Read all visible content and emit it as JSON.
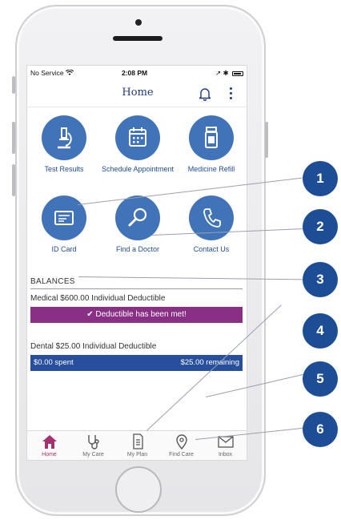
{
  "status_bar": {
    "carrier": "No Service",
    "time": "2:08 PM",
    "right": "↗ ✱"
  },
  "header": {
    "title": "Home"
  },
  "tiles": [
    {
      "label": "Test Results",
      "icon": "microscope-icon"
    },
    {
      "label": "Schedule Appointment",
      "icon": "calendar-icon"
    },
    {
      "label": "Medicine Refill",
      "icon": "pill-bottle-icon"
    },
    {
      "label": "ID Card",
      "icon": "id-card-icon"
    },
    {
      "label": "Find a Doctor",
      "icon": "magnifier-icon"
    },
    {
      "label": "Contact Us",
      "icon": "phone-icon"
    }
  ],
  "balances": {
    "heading": "BALANCES",
    "medical_label": "Medical $600.00 Individual Deductible",
    "medical_status": "✔ Deductible has been met!",
    "dental_label": "Dental $25.00 Individual Deductible",
    "dental_spent": "$0.00 spent",
    "dental_remaining": "$25.00 remaining"
  },
  "tabs": [
    {
      "label": "Home",
      "icon": "house-icon",
      "active": true
    },
    {
      "label": "My Care",
      "icon": "stethoscope-icon",
      "active": false
    },
    {
      "label": "My Plan",
      "icon": "document-icon",
      "active": false
    },
    {
      "label": "Find Care",
      "icon": "location-pin-icon",
      "active": false
    },
    {
      "label": "Inbox",
      "icon": "envelope-icon",
      "active": false
    }
  ],
  "callouts": [
    "1",
    "2",
    "3",
    "4",
    "5",
    "6"
  ],
  "colors": {
    "tile_blue": "#4173b8",
    "brand_navy": "#1f3a7a",
    "met_purple": "#8a2f86",
    "dental_blue": "#274f9e",
    "callout_blue": "#1d4e95",
    "active_tab": "#a3326f"
  }
}
